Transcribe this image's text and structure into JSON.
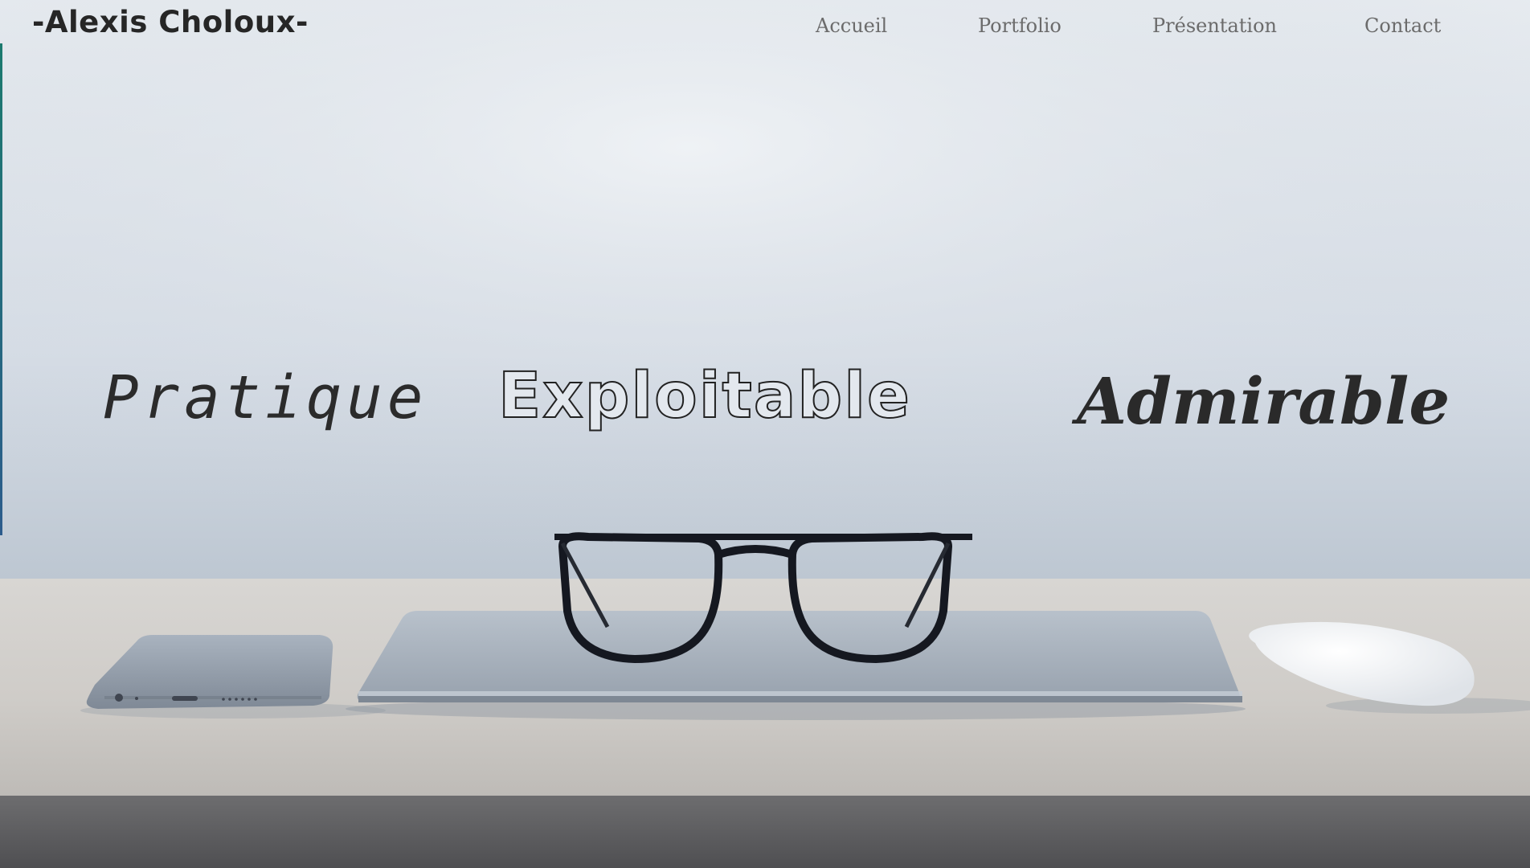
{
  "header": {
    "brand": "-Alexis Choloux-",
    "nav": [
      {
        "label": "Accueil"
      },
      {
        "label": "Portfolio"
      },
      {
        "label": "Présentation"
      },
      {
        "label": "Contact"
      }
    ]
  },
  "hero": {
    "words": [
      "Pratique",
      "Exploitable",
      "Admirable"
    ],
    "image": "desk-with-glasses-laptop-phone-mouse"
  },
  "colors": {
    "text": "#2b2b2b",
    "nav": "#6b6b6b",
    "wall": "#dfe5ec",
    "desk": "#d9d6d2"
  }
}
